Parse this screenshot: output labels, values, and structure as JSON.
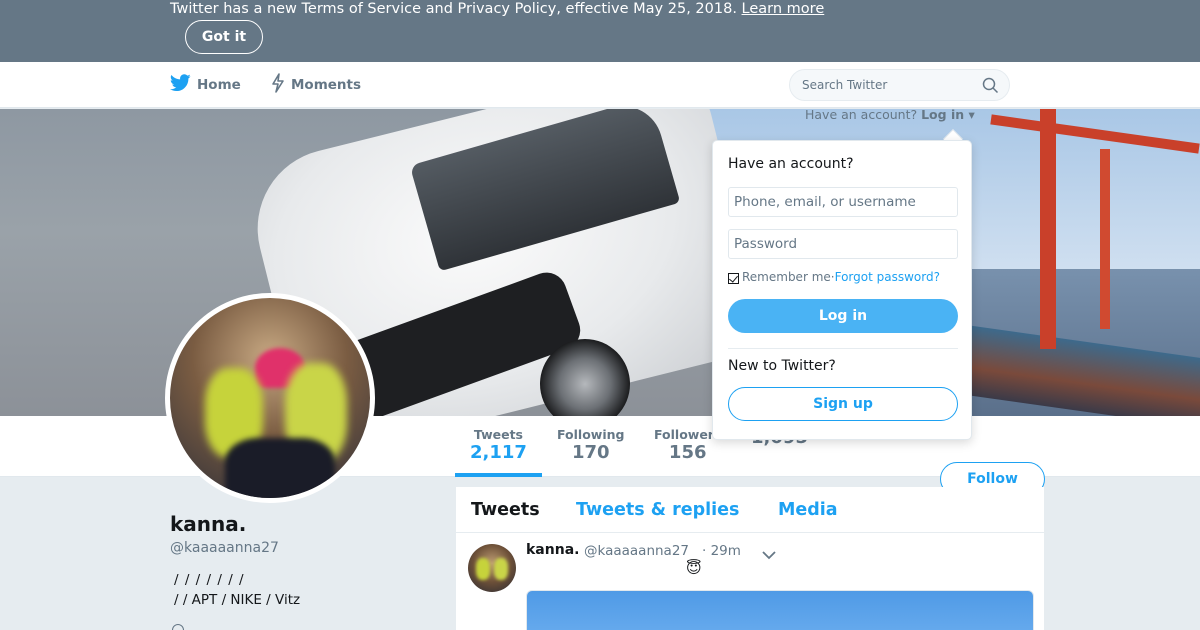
{
  "banner": {
    "text": "Twitter has a new Terms of Service and Privacy Policy, effective May 25, 2018.",
    "link": "Learn more",
    "button": "Got it"
  },
  "nav": {
    "home": "Home",
    "moments": "Moments",
    "search_placeholder": "Search Twitter"
  },
  "login": {
    "prompt": "Have an account?",
    "link": "Log in",
    "dropdown": {
      "title": "Have an account?",
      "username_placeholder": "Phone, email, or username",
      "password_placeholder": "Password",
      "remember": "Remember me",
      "separator": " · ",
      "forgot": "Forgot password?",
      "login_button": "Log in",
      "new_prompt": "New to Twitter?",
      "signup_button": "Sign up"
    }
  },
  "stats": [
    {
      "label": "Tweets",
      "value": "2,117",
      "active": true
    },
    {
      "label": "Following",
      "value": "170"
    },
    {
      "label": "Followers",
      "value": "156"
    },
    {
      "label": "",
      "value": "1,095"
    }
  ],
  "follow_button": "Follow",
  "profile": {
    "name": "kanna.",
    "handle": "@kaaaaanna27",
    "bio_line1": "/ / / / / / /",
    "bio_line2": "/ / APT / NIKE / Vitz"
  },
  "timeline": {
    "tabs": [
      "Tweets",
      "Tweets & replies",
      "Media"
    ],
    "tweet": {
      "name": "kanna.",
      "handle": "@kaaaaanna27",
      "time": "· 29m",
      "emoji": "😇"
    }
  },
  "colors": {
    "brand": "#1da1f2",
    "banner_bg": "#657786"
  }
}
